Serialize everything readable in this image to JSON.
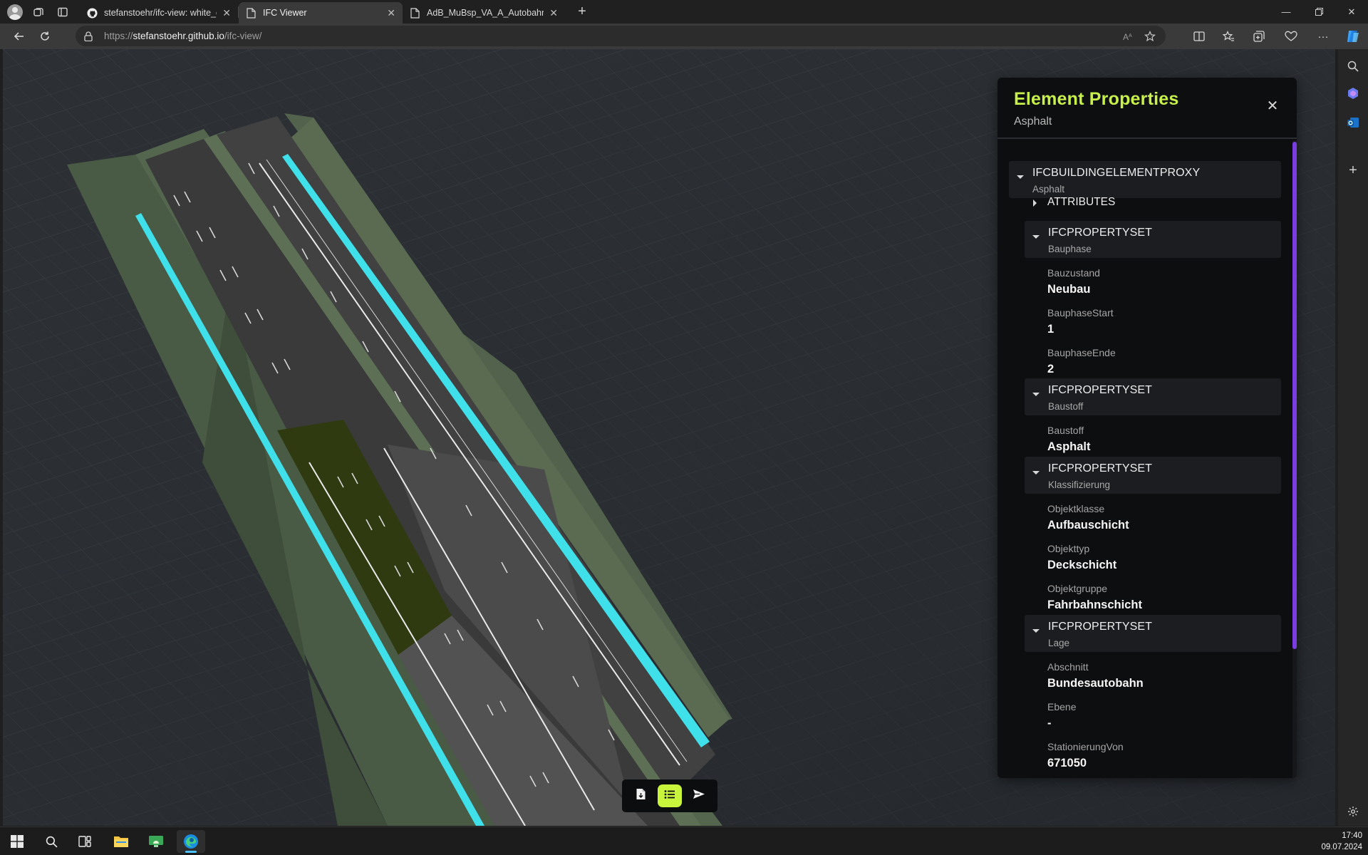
{
  "browser": {
    "tabs": [
      {
        "label": "stefanstoehr/ifc-view: white_che",
        "icon": "github-icon",
        "active": false
      },
      {
        "label": "IFC Viewer",
        "icon": "page-icon",
        "active": true
      },
      {
        "label": "AdB_MuBsp_VA_A_Autobahn.ifc",
        "icon": "page-icon",
        "active": false
      }
    ],
    "url": {
      "protocol": "https://",
      "host": "stefanstoehr.github.io",
      "path": "/ifc-view/"
    }
  },
  "panel": {
    "title": "Element Properties",
    "subtitle": "Asphalt",
    "root": {
      "type": "IFCBUILDINGELEMENTPROXY",
      "name": "Asphalt"
    },
    "attributes_label": "ATTRIBUTES",
    "propertysets": [
      {
        "type": "IFCPROPERTYSET",
        "name": "Bauphase",
        "properties": [
          {
            "key": "Bauzustand",
            "value": "Neubau"
          },
          {
            "key": "BauphaseStart",
            "value": "1"
          },
          {
            "key": "BauphaseEnde",
            "value": "2"
          }
        ]
      },
      {
        "type": "IFCPROPERTYSET",
        "name": "Baustoff",
        "properties": [
          {
            "key": "Baustoff",
            "value": "Asphalt"
          }
        ]
      },
      {
        "type": "IFCPROPERTYSET",
        "name": "Klassifizierung",
        "properties": [
          {
            "key": "Objektklasse",
            "value": "Aufbauschicht"
          },
          {
            "key": "Objekttyp",
            "value": "Deckschicht"
          },
          {
            "key": "Objektgruppe",
            "value": "Fahrbahnschicht"
          }
        ]
      },
      {
        "type": "IFCPROPERTYSET",
        "name": "Lage",
        "properties": [
          {
            "key": "Abschnitt",
            "value": "Bundesautobahn"
          },
          {
            "key": "Ebene",
            "value": "-"
          },
          {
            "key": "StationierungVon",
            "value": "671050"
          }
        ]
      }
    ]
  },
  "toolbar": {
    "buttons": [
      {
        "icon": "load-file-icon",
        "active": false
      },
      {
        "icon": "list-properties-icon",
        "active": true
      },
      {
        "icon": "send-icon",
        "active": false
      }
    ],
    "accent": "#c8f53b"
  },
  "colors": {
    "panel_title": "#c7f04a",
    "scrollbar": "#7a3de0",
    "curb_cyan": "#3fe0ea",
    "selected_asphalt": "#2f3a10"
  },
  "taskbar": {
    "time": "17:40",
    "date": "09.07.2024"
  }
}
